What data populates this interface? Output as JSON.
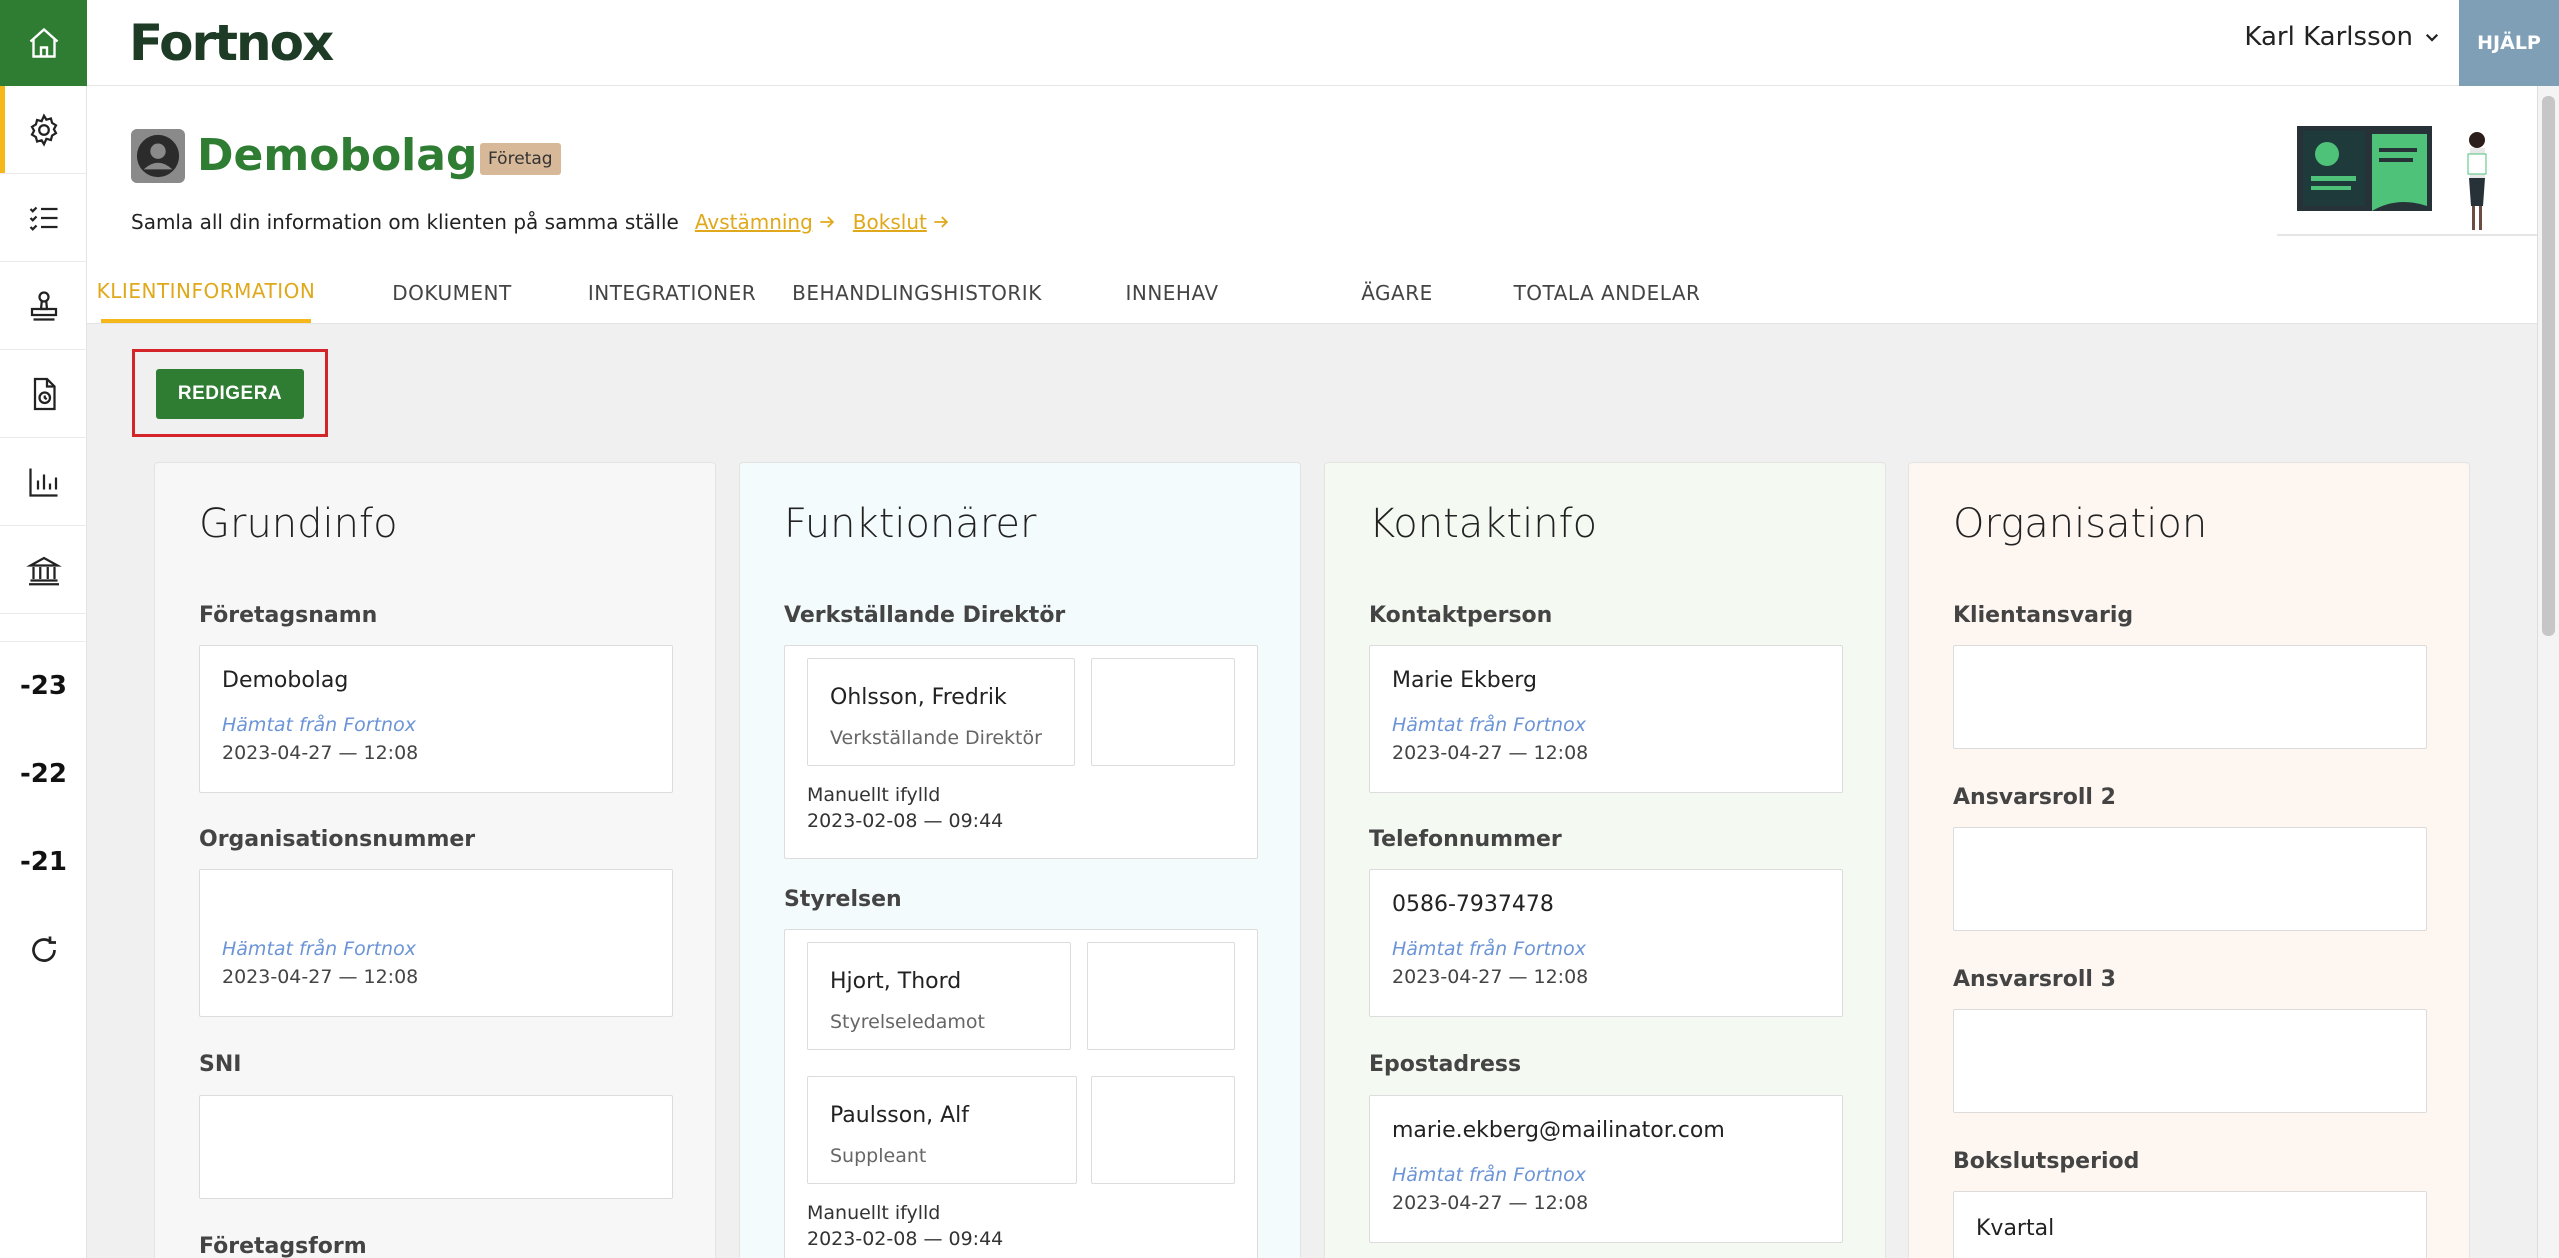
{
  "app": {
    "logo": "Fortnox",
    "user": "Karl Karlsson",
    "help": "HJÄLP"
  },
  "rail": {
    "years": [
      "-23",
      "-22",
      "-21"
    ]
  },
  "client": {
    "name": "Demobolag",
    "badge": "Företag",
    "subtitle": "Samla all din information om klienten på samma ställe",
    "link1": "Avstämning",
    "link2": "Bokslut"
  },
  "tabs": [
    "KLIENTINFORMATION",
    "DOKUMENT",
    "INTEGRATIONER",
    "BEHANDLINGSHISTORIK",
    "INNEHAV",
    "ÄGARE",
    "TOTALA ANDELAR"
  ],
  "edit_label": "REDIGERA",
  "grundinfo": {
    "title": "Grundinfo",
    "f1_label": "Företagsnamn",
    "f1_value": "Demobolag",
    "f1_src": "Hämtat från Fortnox",
    "f1_date": "2023-04-27 — 12:08",
    "f2_label": "Organisationsnummer",
    "f2_src": "Hämtat från Fortnox",
    "f2_date": "2023-04-27 — 12:08",
    "f3_label": "SNI",
    "f4_label": "Företagsform"
  },
  "funktionarer": {
    "title": "Funktionärer",
    "vd_label": "Verkställande Direktör",
    "vd_name": "Ohlsson, Fredrik",
    "vd_role": "Verkställande Direktör",
    "vd_manual": "Manuellt ifylld",
    "vd_date": "2023-02-08 — 09:44",
    "board_label": "Styrelsen",
    "b1_name": "Hjort, Thord",
    "b1_role": "Styrelseledamot",
    "b2_name": "Paulsson, Alf",
    "b2_role": "Suppleant",
    "board_manual": "Manuellt ifylld",
    "board_date": "2023-02-08 — 09:44"
  },
  "kontakt": {
    "title": "Kontaktinfo",
    "c1_label": "Kontaktperson",
    "c1_value": "Marie Ekberg",
    "c1_src": "Hämtat från Fortnox",
    "c1_date": "2023-04-27 — 12:08",
    "c2_label": "Telefonnummer",
    "c2_value": "0586-7937478",
    "c2_src": "Hämtat från Fortnox",
    "c2_date": "2023-04-27 — 12:08",
    "c3_label": "Epostadress",
    "c3_value": "marie.ekberg@mailinator.com",
    "c3_src": "Hämtat från Fortnox",
    "c3_date": "2023-04-27 — 12:08"
  },
  "organisation": {
    "title": "Organisation",
    "o1_label": "Klientansvarig",
    "o2_label": "Ansvarsroll 2",
    "o3_label": "Ansvarsroll 3",
    "o4_label": "Bokslutsperiod",
    "o4_value": "Kvartal"
  },
  "colors": {
    "brand_green": "#2f7d32",
    "accent_yellow": "#f6b71b",
    "link": "#6b94d6",
    "highlight": "#d5232a"
  }
}
